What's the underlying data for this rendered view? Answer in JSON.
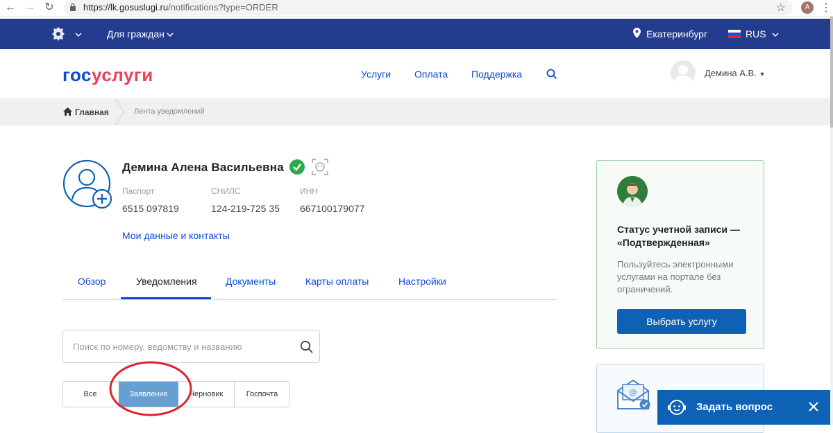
{
  "browser": {
    "url_host": "https://lk.gosuslugi.ru",
    "url_path": "/notifications?type=ORDER",
    "profile_initial": "A"
  },
  "topbar": {
    "audience_label": "Для граждан",
    "city": "Екатеринбург",
    "language": "RUS",
    "bg_color": "#233c8e"
  },
  "header": {
    "logo_part1": "гос",
    "logo_part2": "услуги",
    "nav": [
      "Услуги",
      "Оплата",
      "Поддержка"
    ],
    "user_name": "Демина А.В."
  },
  "breadcrumb": {
    "home": "Главная",
    "current": "Лента уведомлений"
  },
  "profile": {
    "full_name": "Демина Алена Васильевна",
    "passport_label": "Паспорт",
    "passport_value": "6515 097819",
    "snils_label": "СНИЛС",
    "snils_value": "124-219-725 35",
    "inn_label": "ИНН",
    "inn_value": "667100179077",
    "my_data_link": "Мои данные и контакты"
  },
  "tabs": [
    "Обзор",
    "Уведомления",
    "Документы",
    "Карты оплаты",
    "Настройки"
  ],
  "active_tab": "Уведомления",
  "search": {
    "placeholder": "Поиск по номеру, ведомству и названию"
  },
  "filters": [
    "Все",
    "Заявление",
    "Черновик",
    "Госпочта"
  ],
  "active_filter": "Заявление",
  "status_card": {
    "title": "Статус учетной записи — «Подтвержденная»",
    "description": "Пользуйтесь электронными услугами на портале без ограничений.",
    "button": "Выбрать услугу"
  },
  "ask": {
    "label": "Задать вопрос"
  },
  "colors": {
    "accent": "#0d4cd3",
    "logo_red": "#ee3f58",
    "button": "#0d62b6",
    "verified": "#2fa84f"
  }
}
